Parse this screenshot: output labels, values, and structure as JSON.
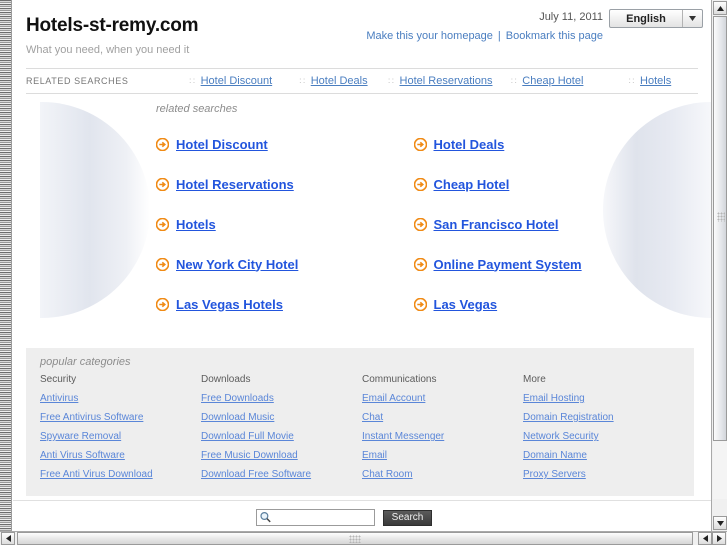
{
  "header": {
    "site_title": "Hotels-st-remy.com",
    "tagline": "What you need, when you need it",
    "date": "July 11, 2011",
    "language_value": "English",
    "homepage_link": "Make this your homepage",
    "bookmark_link": "Bookmark this page",
    "separator": "|"
  },
  "related_strip": {
    "label": "RELATED SEARCHES",
    "items": [
      {
        "label": "Hotel Discount"
      },
      {
        "label": "Hotel Deals"
      },
      {
        "label": "Hotel Reservations"
      },
      {
        "label": "Cheap Hotel"
      },
      {
        "label": "Hotels"
      }
    ]
  },
  "main": {
    "heading": "related searches",
    "left_column": [
      {
        "label": "Hotel Discount"
      },
      {
        "label": "Hotel Reservations"
      },
      {
        "label": "Hotels"
      },
      {
        "label": "New York City Hotel"
      },
      {
        "label": "Las Vegas Hotels"
      }
    ],
    "right_column": [
      {
        "label": "Hotel Deals"
      },
      {
        "label": "Cheap Hotel"
      },
      {
        "label": "San Francisco Hotel"
      },
      {
        "label": "Online Payment System"
      },
      {
        "label": "Las Vegas"
      }
    ]
  },
  "categories": {
    "heading": "popular categories",
    "columns": [
      {
        "title": "Security",
        "links": [
          "Antivirus",
          "Free Antivirus Software",
          "Spyware Removal",
          "Anti Virus Software",
          "Free Anti Virus Download"
        ]
      },
      {
        "title": "Downloads",
        "links": [
          "Free Downloads",
          "Download Music",
          "Download Full Movie",
          "Free Music Download",
          "Download Free Software"
        ]
      },
      {
        "title": "Communications",
        "links": [
          "Email Account",
          "Chat",
          "Instant Messenger",
          "Email",
          "Chat Room"
        ]
      },
      {
        "title": "More",
        "links": [
          "Email Hosting",
          "Domain Registration",
          "Network Security",
          "Domain Name",
          "Proxy Servers"
        ]
      }
    ]
  },
  "search": {
    "value": "",
    "placeholder": "",
    "button_label": "Search"
  },
  "colors": {
    "link_blue": "#2255dd",
    "small_link_blue": "#5a86d8",
    "bullet_orange": "#f28c1b",
    "panel_grey": "#eeeeee",
    "muted_text": "#8c8c8c"
  }
}
